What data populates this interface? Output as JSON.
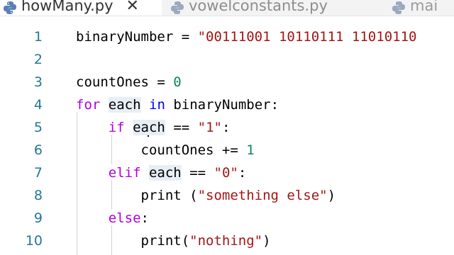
{
  "tabs": [
    {
      "label": "howMany.py",
      "active": true,
      "close": "✕"
    },
    {
      "label": "vowelconstants.py",
      "active": false
    },
    {
      "label": "mai",
      "active": false
    }
  ],
  "colors": {
    "keyword_control": "#af00db",
    "keyword": "#0000ff",
    "string": "#a31515",
    "number": "#098658",
    "line_number": "#237893"
  },
  "lines": [
    {
      "n": "1",
      "tokens": [
        [
          "",
          "binaryNumber = "
        ],
        [
          "str",
          "\"00111001 10110111 11010110"
        ]
      ]
    },
    {
      "n": "2",
      "tokens": []
    },
    {
      "n": "3",
      "tokens": [
        [
          "",
          "countOnes = "
        ],
        [
          "num",
          "0"
        ]
      ]
    },
    {
      "n": "4",
      "tokens": [
        [
          "kw",
          "for"
        ],
        [
          "",
          " "
        ],
        [
          "hl",
          "each"
        ],
        [
          "",
          " "
        ],
        [
          "kwb",
          "in"
        ],
        [
          "",
          " binaryNumber:"
        ]
      ]
    },
    {
      "n": "5",
      "tokens": [
        [
          "",
          "    "
        ],
        [
          "kw",
          "if"
        ],
        [
          "",
          " "
        ],
        [
          "hl",
          "each"
        ],
        [
          "",
          " == "
        ],
        [
          "str",
          "\"1\""
        ],
        [
          "",
          ":"
        ]
      ]
    },
    {
      "n": "6",
      "tokens": [
        [
          "",
          "        countOnes += "
        ],
        [
          "num",
          "1"
        ]
      ]
    },
    {
      "n": "7",
      "tokens": [
        [
          "",
          "    "
        ],
        [
          "kw",
          "elif"
        ],
        [
          "",
          " "
        ],
        [
          "hl",
          "each"
        ],
        [
          "",
          " == "
        ],
        [
          "str",
          "\"0\""
        ],
        [
          "",
          ":"
        ]
      ]
    },
    {
      "n": "8",
      "tokens": [
        [
          "",
          "        print ("
        ],
        [
          "str",
          "\"something else\""
        ],
        [
          "",
          ")"
        ]
      ]
    },
    {
      "n": "9",
      "tokens": [
        [
          "",
          "    "
        ],
        [
          "kw",
          "else"
        ],
        [
          "",
          ":"
        ]
      ]
    },
    {
      "n": "10",
      "tokens": [
        [
          "",
          "        print("
        ],
        [
          "str",
          "\"nothing\""
        ],
        [
          "",
          ")"
        ]
      ]
    }
  ]
}
